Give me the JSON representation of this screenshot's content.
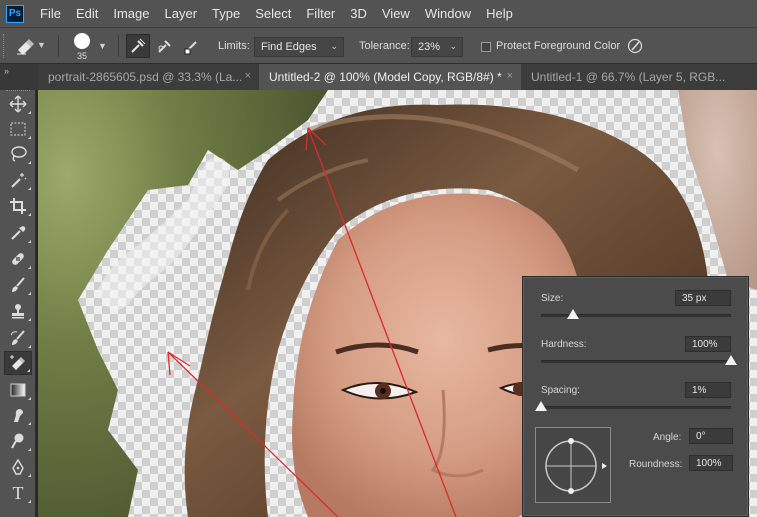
{
  "app": {
    "logo_text": "Ps",
    "menu": [
      "File",
      "Edit",
      "Image",
      "Layer",
      "Type",
      "Select",
      "Filter",
      "3D",
      "View",
      "Window",
      "Help"
    ]
  },
  "options": {
    "brush_size": "35",
    "limits_label": "Limits:",
    "limits_value": "Find Edges",
    "tolerance_label": "Tolerance:",
    "tolerance_value": "23%",
    "protect_label": "Protect Foreground Color"
  },
  "tabs": [
    {
      "label": "portrait-2865605.psd @ 33.3% (La...",
      "active": false
    },
    {
      "label": "Untitled-2 @ 100% (Model Copy, RGB/8#) *",
      "active": true
    },
    {
      "label": "Untitled-1 @ 66.7% (Layer 5, RGB...",
      "active": false
    }
  ],
  "tab_close": "×",
  "panel_collapse": "»",
  "tools": [
    {
      "name": "move-tool",
      "icon": "move-icon"
    },
    {
      "name": "marquee-tool",
      "icon": "marquee-icon"
    },
    {
      "name": "lasso-tool",
      "icon": "lasso-icon"
    },
    {
      "name": "magic-wand-tool",
      "icon": "magic-wand-icon"
    },
    {
      "name": "crop-tool",
      "icon": "crop-icon"
    },
    {
      "name": "eyedropper-tool",
      "icon": "eyedropper-icon"
    },
    {
      "name": "healing-brush-tool",
      "icon": "bandage-icon"
    },
    {
      "name": "brush-tool",
      "icon": "brush-icon"
    },
    {
      "name": "clone-stamp-tool",
      "icon": "stamp-icon"
    },
    {
      "name": "history-brush-tool",
      "icon": "history-brush-icon"
    },
    {
      "name": "background-eraser-tool",
      "icon": "eraser-icon",
      "active": true
    },
    {
      "name": "gradient-tool",
      "icon": "gradient-icon"
    },
    {
      "name": "smudge-tool",
      "icon": "smudge-icon"
    },
    {
      "name": "dodge-tool",
      "icon": "dodge-icon"
    },
    {
      "name": "pen-tool",
      "icon": "pen-icon"
    },
    {
      "name": "type-tool",
      "icon": "type-icon"
    }
  ],
  "type_tool_glyph": "T",
  "brush_panel": {
    "size_label": "Size:",
    "size_value": "35 px",
    "size_level": 0.17,
    "hardness_label": "Hardness:",
    "hardness_value": "100%",
    "hardness_level": 1.0,
    "spacing_label": "Spacing:",
    "spacing_value": "1%",
    "spacing_level": 0.0,
    "angle_label": "Angle:",
    "angle_value": "0°",
    "roundness_label": "Roundness:",
    "roundness_value": "100%"
  },
  "colors": {
    "chrome": "#535353",
    "panel": "#4b4b4b",
    "accent_blue": "#31a8ff",
    "stroke_red": "#d92b2b"
  }
}
